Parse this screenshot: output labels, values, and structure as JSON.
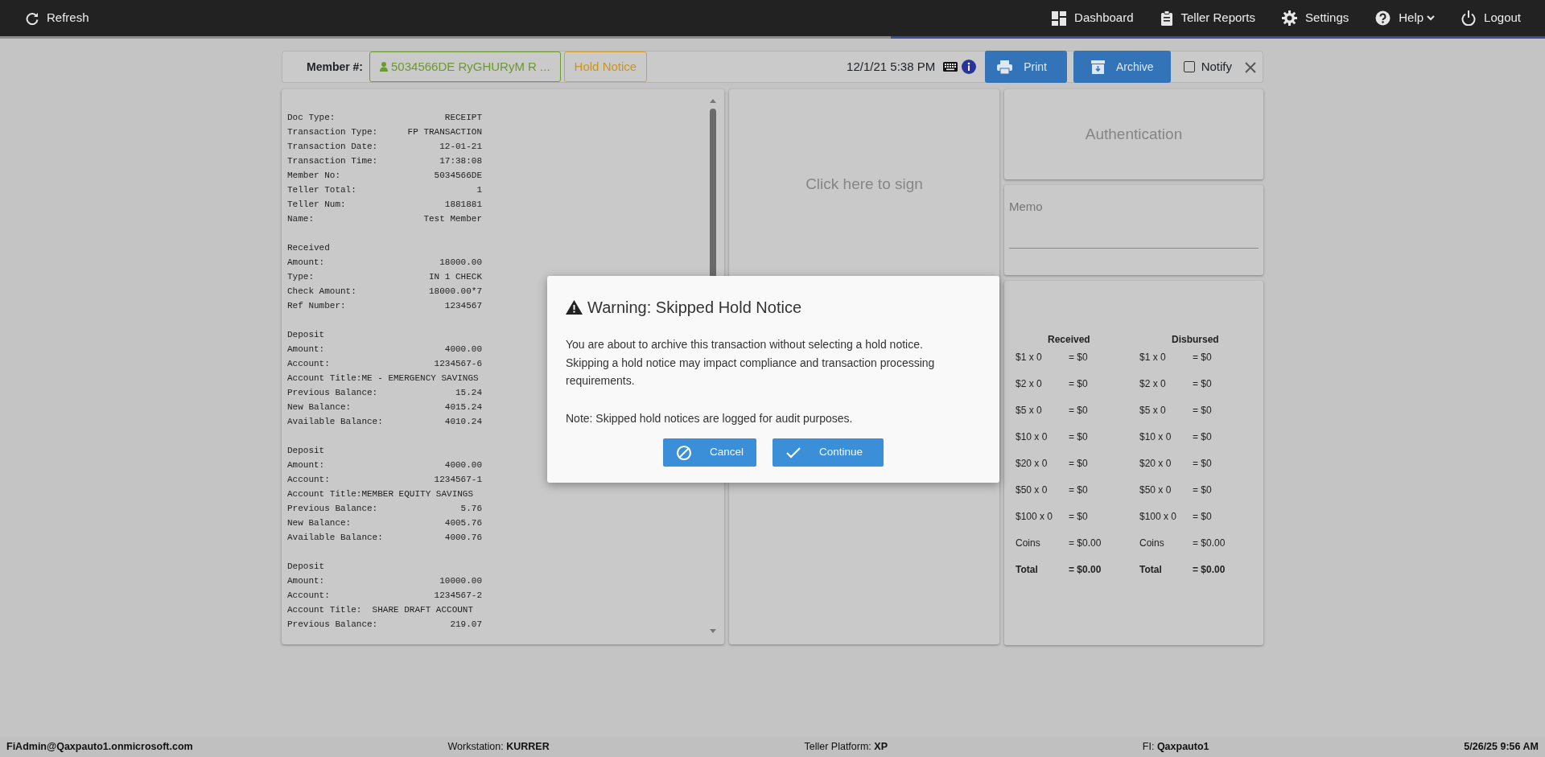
{
  "navbar": {
    "left": [
      {
        "label": "Refresh"
      }
    ],
    "right": [
      {
        "label": "Dashboard",
        "dropdown": false
      },
      {
        "label": "Teller Reports",
        "dropdown": false
      },
      {
        "label": "Settings",
        "dropdown": false
      },
      {
        "label": "Help",
        "dropdown": true
      },
      {
        "label": "Logout",
        "dropdown": false
      }
    ]
  },
  "member_bar": {
    "label": "Member #:",
    "member": "5034566DE RyGHURyM R ...",
    "hold_notice": "Hold Notice",
    "datetime": "12/1/21 5:38 PM",
    "print": "Print",
    "archive": "Archive",
    "notify": {
      "label": "Notify",
      "checked": false
    }
  },
  "receipt": {
    "sections": [
      {
        "lines": [
          {
            "label": "Doc Type:",
            "value": "RECEIPT"
          },
          {
            "label": "Transaction Type:",
            "value": "FP TRANSACTION"
          },
          {
            "label": "Transaction Date:",
            "value": "12-01-21"
          },
          {
            "label": "Transaction Time:",
            "value": "17:38:08"
          },
          {
            "label": "Member No:",
            "value": "5034566DE"
          },
          {
            "label": "Teller Total:",
            "value": "1"
          },
          {
            "label": "Teller Num:",
            "value": "1881881"
          },
          {
            "label": "Name:",
            "value": "Test Member"
          }
        ]
      },
      {
        "heading": "Received",
        "lines": [
          {
            "label": "Amount:",
            "value": "18000.00"
          },
          {
            "label": "Type:",
            "value": "IN 1 CHECK"
          },
          {
            "label": "Check Amount:",
            "value": "18000.00*7"
          },
          {
            "label": "Ref Number:",
            "value": "1234567"
          }
        ]
      },
      {
        "heading": "Deposit",
        "lines": [
          {
            "label": "Amount:",
            "value": "4000.00"
          },
          {
            "label": "Account:",
            "value": "1234567-6"
          },
          {
            "text": "Account Title:ME - EMERGENCY SAVINGS"
          },
          {
            "label": "Previous Balance:",
            "value": "15.24"
          },
          {
            "label": "New Balance:",
            "value": "4015.24"
          },
          {
            "label": "Available Balance:",
            "value": "4010.24"
          }
        ]
      },
      {
        "heading": "Deposit",
        "lines": [
          {
            "label": "Amount:",
            "value": "4000.00"
          },
          {
            "label": "Account:",
            "value": "1234567-1"
          },
          {
            "text": "Account Title:MEMBER EQUITY SAVINGS"
          },
          {
            "label": "Previous Balance:",
            "value": "5.76"
          },
          {
            "label": "New Balance:",
            "value": "4005.76"
          },
          {
            "label": "Available Balance:",
            "value": "4000.76"
          }
        ]
      },
      {
        "heading": "Deposit",
        "lines": [
          {
            "label": "Amount:",
            "value": "10000.00"
          },
          {
            "label": "Account:",
            "value": "1234567-2"
          },
          {
            "text": "Account Title:  SHARE DRAFT ACCOUNT"
          },
          {
            "label": "Previous Balance:",
            "value": "219.07"
          }
        ]
      }
    ]
  },
  "signature": {
    "prompt": "Click here to sign"
  },
  "authentication": {
    "title": "Authentication"
  },
  "memo": {
    "label": "Memo"
  },
  "cash": {
    "columns": [
      {
        "title": "Received",
        "rows": [
          {
            "kind": "item",
            "label": "$1 x 0",
            "amount": "= $0"
          },
          {
            "kind": "item",
            "label": "$2 x 0",
            "amount": "= $0"
          },
          {
            "kind": "item",
            "label": "$5 x 0",
            "amount": "= $0"
          },
          {
            "kind": "item",
            "label": "$10 x 0",
            "amount": "= $0"
          },
          {
            "kind": "item",
            "label": "$20 x 0",
            "amount": "= $0"
          },
          {
            "kind": "item",
            "label": "$50 x 0",
            "amount": "= $0"
          },
          {
            "kind": "item",
            "label": "$100 x 0",
            "amount": "= $0"
          },
          {
            "kind": "item",
            "label": "Coins",
            "amount": "= $0.00"
          },
          {
            "kind": "total",
            "label": "Total",
            "amount": "= $0.00"
          }
        ]
      },
      {
        "title": "Disbursed",
        "rows": [
          {
            "kind": "item",
            "label": "$1 x 0",
            "amount": "= $0"
          },
          {
            "kind": "item",
            "label": "$2 x 0",
            "amount": "= $0"
          },
          {
            "kind": "item",
            "label": "$5 x 0",
            "amount": "= $0"
          },
          {
            "kind": "item",
            "label": "$10 x 0",
            "amount": "= $0"
          },
          {
            "kind": "item",
            "label": "$20 x 0",
            "amount": "= $0"
          },
          {
            "kind": "item",
            "label": "$50 x 0",
            "amount": "= $0"
          },
          {
            "kind": "item",
            "label": "$100 x 0",
            "amount": "= $0"
          },
          {
            "kind": "item",
            "label": "Coins",
            "amount": "= $0.00"
          },
          {
            "kind": "total",
            "label": "Total",
            "amount": "= $0.00"
          }
        ]
      }
    ]
  },
  "modal": {
    "title": "Warning: Skipped Hold Notice",
    "message": "You are about to archive this transaction without selecting a hold notice. Skipping a hold notice may impact compliance and transaction processing requirements.",
    "note": "Note: Skipped hold notices are logged for audit purposes.",
    "buttons": [
      {
        "kind": "cancel",
        "label": "Cancel"
      },
      {
        "kind": "continue",
        "label": "Continue"
      }
    ]
  },
  "status_bar": {
    "user": "FiAdmin@Qaxpauto1.onmicrosoft.com",
    "workstation": "Workstation: **KURRER**",
    "platform": "Teller Platform: **XP**",
    "fi": "FI: **Qaxpauto1**",
    "datetime": "5/26/25 9:56 AM"
  }
}
